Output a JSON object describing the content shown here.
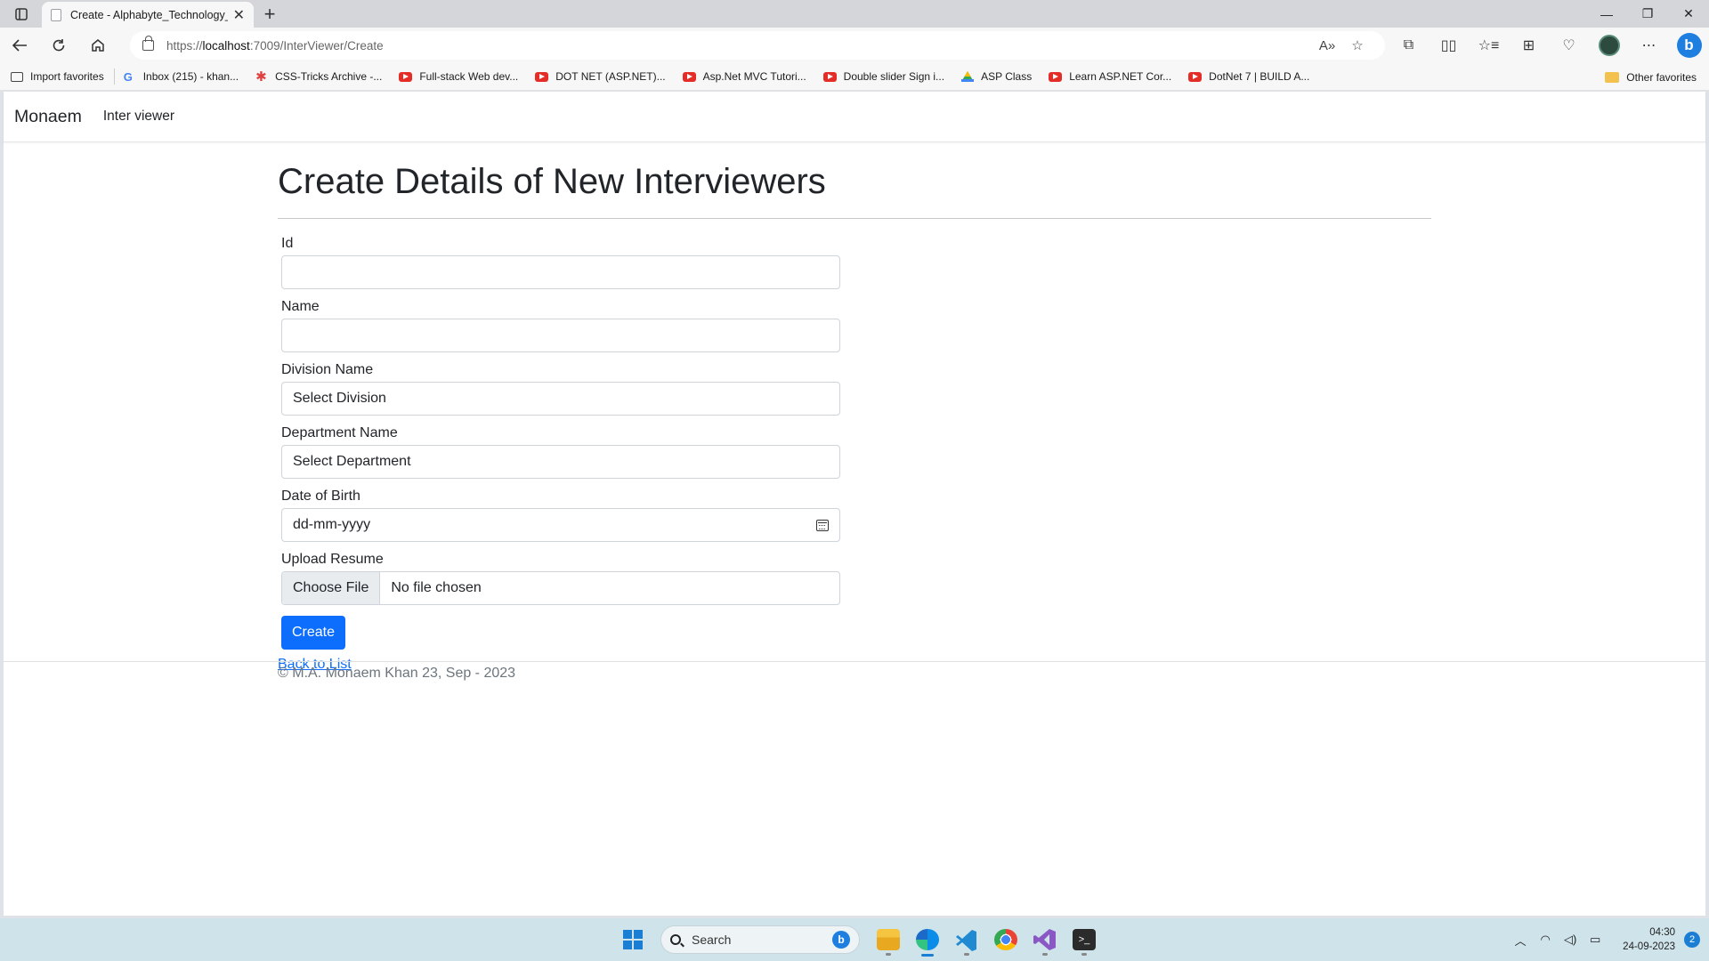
{
  "browser": {
    "tab_title": "Create - Alphabyte_Technology_",
    "url_prefix": "https://",
    "url_host": "localhost",
    "url_rest": ":7009/InterViewer/Create",
    "bookmarks": [
      {
        "label": "Import favorites",
        "icon": "import-icon"
      },
      {
        "label": "Inbox (215) - khan...",
        "icon": "google-icon"
      },
      {
        "label": "CSS-Tricks Archive -...",
        "icon": "css-tricks-icon"
      },
      {
        "label": "Full-stack Web dev...",
        "icon": "youtube-icon"
      },
      {
        "label": "DOT NET (ASP.NET)...",
        "icon": "youtube-icon"
      },
      {
        "label": "Asp.Net MVC Tutori...",
        "icon": "youtube-icon"
      },
      {
        "label": "Double slider Sign i...",
        "icon": "youtube-icon"
      },
      {
        "label": "ASP Class",
        "icon": "google-drive-icon"
      },
      {
        "label": "Learn ASP.NET Cor...",
        "icon": "youtube-icon"
      },
      {
        "label": "DotNet 7 | BUILD A...",
        "icon": "youtube-icon"
      }
    ],
    "other_favorites": "Other favorites"
  },
  "site": {
    "brand": "Monaem",
    "nav_link": "Inter viewer"
  },
  "page": {
    "title": "Create Details of New Interviewers",
    "fields": {
      "id_label": "Id",
      "id_value": "",
      "name_label": "Name",
      "name_value": "",
      "division_label": "Division Name",
      "division_selected": "Select Division",
      "department_label": "Department Name",
      "department_selected": "Select Department",
      "dob_label": "Date of Birth",
      "dob_placeholder": "dd-mm-yyyy",
      "resume_label": "Upload Resume",
      "choose_file": "Choose File",
      "no_file": "No file chosen"
    },
    "create_button": "Create",
    "back_link": "Back to List",
    "footer": "© M.A. Monaem Khan 23, Sep - 2023"
  },
  "taskbar": {
    "search_label": "Search",
    "time": "04:30",
    "date": "24-09-2023",
    "notifications": "2"
  }
}
